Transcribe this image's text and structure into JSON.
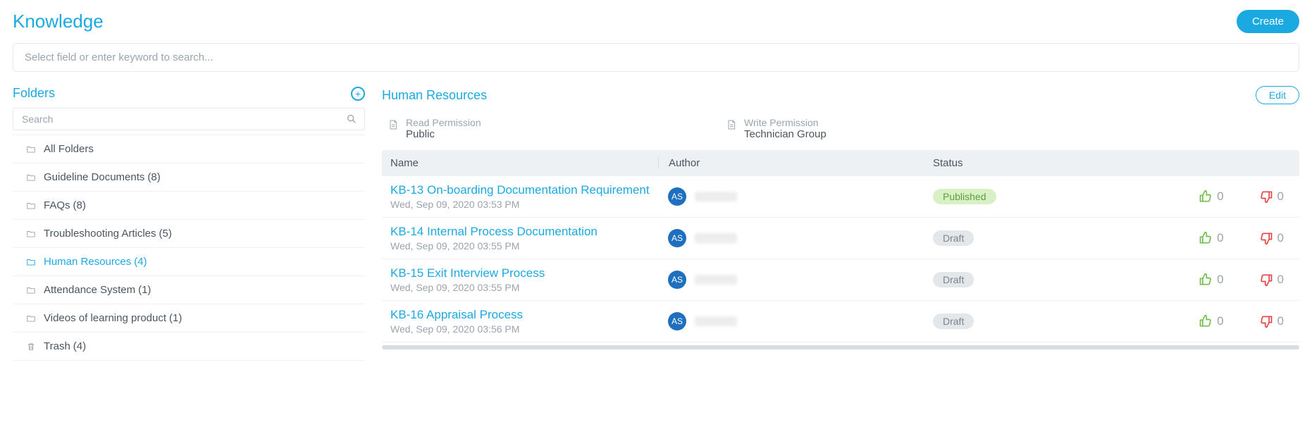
{
  "header": {
    "title": "Knowledge",
    "create_label": "Create"
  },
  "search": {
    "placeholder": "Select field or enter keyword to search..."
  },
  "sidebar": {
    "title": "Folders",
    "search_placeholder": "Search",
    "items": [
      {
        "label": "All Folders",
        "count": "",
        "active": false,
        "type": "folder"
      },
      {
        "label": "Guideline Documents",
        "count": "(8)",
        "active": false,
        "type": "folder"
      },
      {
        "label": "FAQs",
        "count": "(8)",
        "active": false,
        "type": "folder"
      },
      {
        "label": "Troubleshooting Articles",
        "count": "(5)",
        "active": false,
        "type": "folder"
      },
      {
        "label": "Human Resources",
        "count": "(4)",
        "active": true,
        "type": "folder"
      },
      {
        "label": "Attendance System",
        "count": "(1)",
        "active": false,
        "type": "folder"
      },
      {
        "label": "Videos of learning product",
        "count": "(1)",
        "active": false,
        "type": "folder"
      },
      {
        "label": "Trash",
        "count": "(4)",
        "active": false,
        "type": "trash"
      }
    ]
  },
  "main": {
    "title": "Human Resources",
    "edit_label": "Edit",
    "perms": {
      "read": {
        "label": "Read Permission",
        "value": "Public"
      },
      "write": {
        "label": "Write Permission",
        "value": "Technician Group"
      }
    },
    "columns": {
      "name": "Name",
      "author": "Author",
      "status": "Status"
    },
    "rows": [
      {
        "title": "KB-13 On-boarding Documentation Requirement",
        "date": "Wed, Sep 09, 2020 03:53 PM",
        "avatar": "AS",
        "status": "Published",
        "status_class": "published",
        "up": "0",
        "down": "0"
      },
      {
        "title": "KB-14 Internal Process Documentation",
        "date": "Wed, Sep 09, 2020 03:55 PM",
        "avatar": "AS",
        "status": "Draft",
        "status_class": "draft",
        "up": "0",
        "down": "0"
      },
      {
        "title": "KB-15 Exit Interview Process",
        "date": "Wed, Sep 09, 2020 03:55 PM",
        "avatar": "AS",
        "status": "Draft",
        "status_class": "draft",
        "up": "0",
        "down": "0"
      },
      {
        "title": "KB-16 Appraisal Process",
        "date": "Wed, Sep 09, 2020 03:56 PM",
        "avatar": "AS",
        "status": "Draft",
        "status_class": "draft",
        "up": "0",
        "down": "0"
      }
    ]
  }
}
